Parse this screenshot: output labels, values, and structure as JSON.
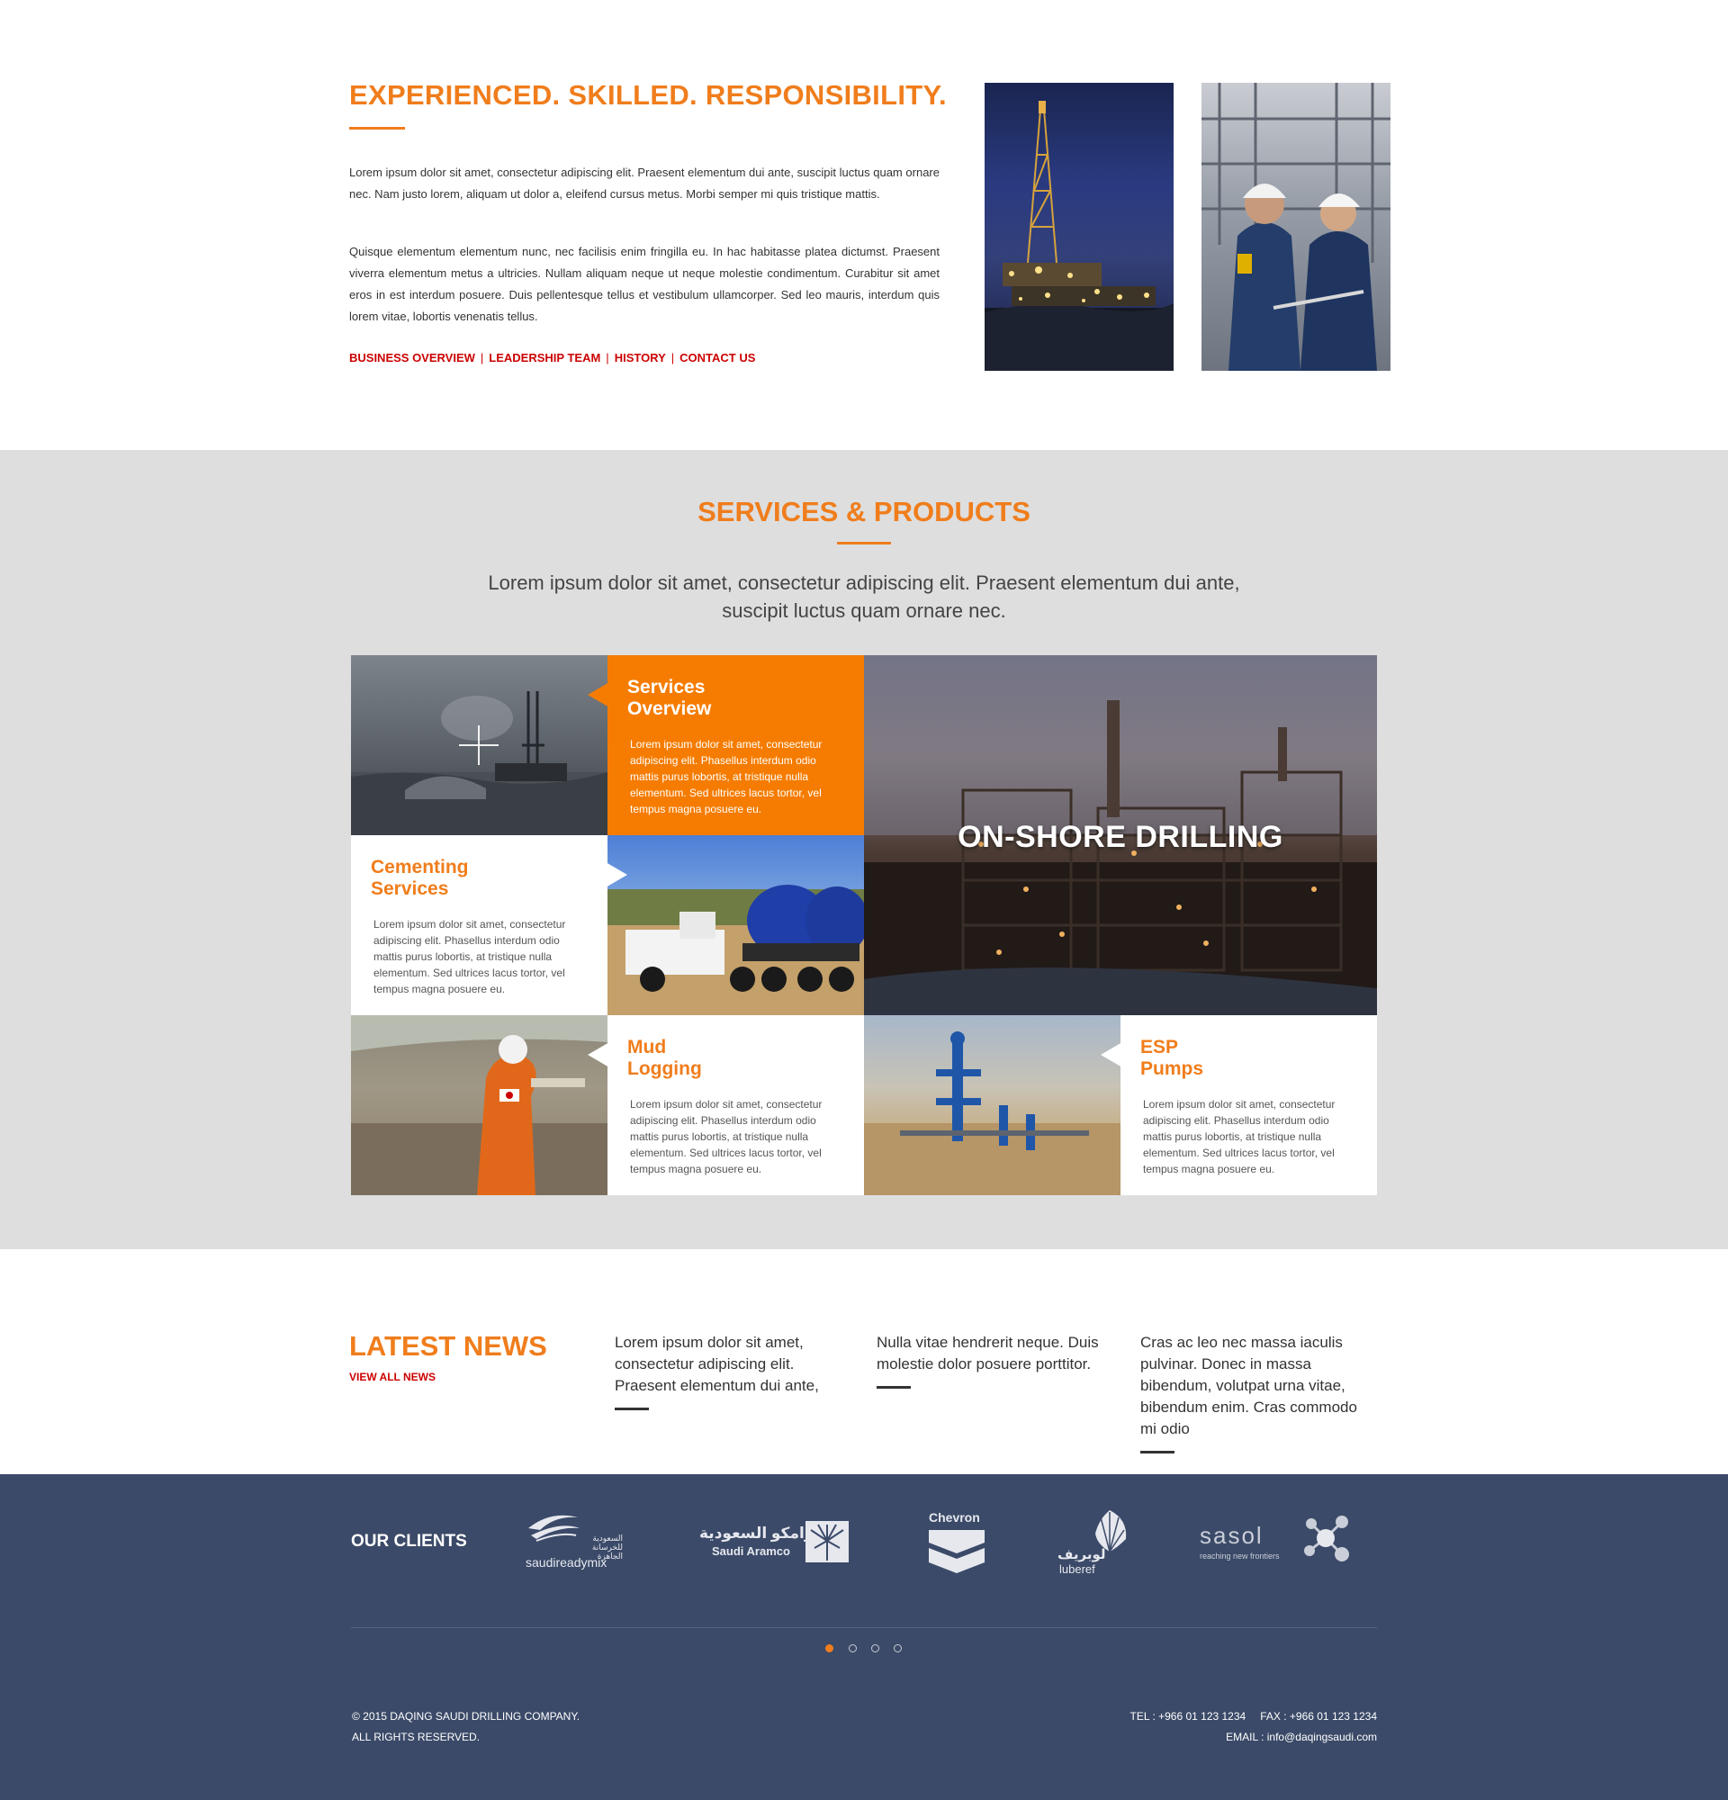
{
  "about": {
    "title": "EXPERIENCED. SKILLED. RESPONSIBILITY.",
    "paragraph1": "Lorem ipsum dolor sit amet, consectetur adipiscing elit. Praesent elementum dui ante, suscipit luctus quam ornare nec. Nam justo lorem, aliquam ut dolor a, eleifend cursus metus. Morbi semper mi quis tristique mattis.",
    "paragraph2": "Quisque elementum elementum nunc, nec facilisis enim fringilla eu. In hac habitasse platea dictumst. Praesent viverra elementum metus a ultricies. Nullam aliquam neque ut neque molestie condimentum. Curabitur sit amet eros in est interdum posuere. Duis pellentesque tellus et vestibulum ullamcorper. Sed leo mauris, interdum quis lorem vitae, lobortis venenatis tellus.",
    "links": [
      "BUSINESS OVERVIEW",
      "LEADERSHIP TEAM",
      "HISTORY",
      "CONTACT US"
    ],
    "separator": "|"
  },
  "services": {
    "title": "SERVICES & PRODUCTS",
    "description": "Lorem ipsum dolor sit amet, consectetur adipiscing elit. Praesent elementum dui ante, suscipit luctus quam ornare nec.",
    "tiles": [
      {
        "heading": "Services\nOverview",
        "text": "Lorem ipsum dolor sit amet, consectetur adipiscing elit. Phasellus interdum odio mattis purus lobortis, at tristique nulla elementum. Sed ultrices lacus tortor, vel tempus magna posuere eu."
      },
      {
        "heading": "Cementing\nServices",
        "text": "Lorem ipsum dolor sit amet, consectetur adipiscing elit. Phasellus interdum odio mattis purus lobortis, at tristique nulla elementum. Sed ultrices lacus tortor, vel tempus magna posuere eu."
      },
      {
        "heading": "Mud\nLogging",
        "text": "Lorem ipsum dolor sit amet, consectetur adipiscing elit. Phasellus interdum odio mattis purus lobortis, at tristique nulla elementum. Sed ultrices lacus tortor, vel tempus magna posuere eu."
      },
      {
        "heading": "ESP\nPumps",
        "text": "Lorem ipsum dolor sit amet, consectetur adipiscing elit. Phasellus interdum odio mattis purus lobortis, at tristique nulla elementum. Sed ultrices lacus tortor, vel tempus magna posuere eu."
      }
    ],
    "feature_label": "ON-SHORE DRILLING"
  },
  "news": {
    "title": "LATEST NEWS",
    "view_all": "VIEW ALL NEWS",
    "items": [
      "Lorem ipsum dolor sit amet, consectetur adipiscing elit. Praesent elementum dui ante,",
      "Nulla vitae hendrerit neque. Duis molestie dolor posuere porttitor.",
      "Cras ac leo nec massa iaculis pulvinar. Donec in massa bibendum, volutpat urna vitae, bibendum enim. Cras commodo mi odio"
    ]
  },
  "footer": {
    "clients_label": "OUR CLIENTS",
    "clients": [
      {
        "name": "saudireadymix",
        "arabic": "السعودية للخرسانة الجاهزة"
      },
      {
        "name": "Saudi Aramco",
        "arabic": "ارامكو السعودية"
      },
      {
        "name": "Chevron"
      },
      {
        "name": "luberef",
        "arabic": "لوبريف"
      },
      {
        "name": "sasol",
        "tagline": "reaching new frontiers"
      }
    ],
    "carousel_active_index": 0,
    "carousel_count": 4,
    "copyright_line1": "© 2015 DAQING SAUDI DRILLING COMPANY.",
    "copyright_line2": "ALL RIGHTS RESERVED.",
    "tel": "TEL : +966 01 123 1234",
    "fax": "FAX :  +966 01 123 1234",
    "email": "EMAIL : info@daqingsaudi.com"
  },
  "colors": {
    "accent": "#f07d1c",
    "link_red": "#cc0000",
    "services_bg": "#dedede",
    "footer_bg": "#3b4a68",
    "tile_orange": "#f57c00"
  }
}
